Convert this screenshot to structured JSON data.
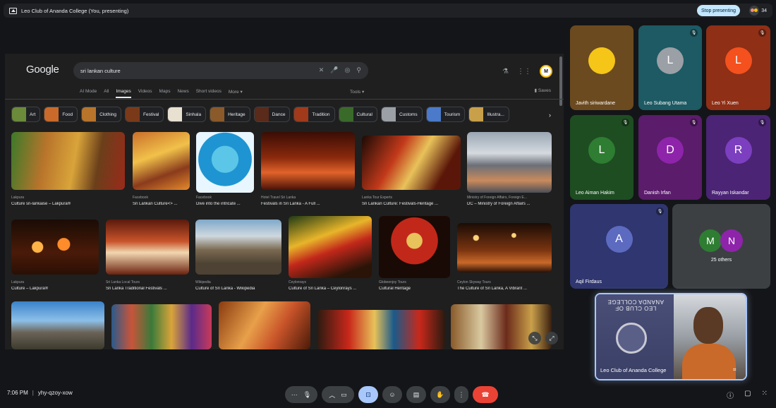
{
  "topbar": {
    "title": "Leo Club of Ananda College (You, presenting)",
    "stop_label": "Stop presenting",
    "participants_count": "34"
  },
  "google": {
    "logo": "Google",
    "query": "sri lankan culture",
    "tabs": [
      "AI Mode",
      "All",
      "Images",
      "Videos",
      "Maps",
      "News",
      "Short videos",
      "More ▾"
    ],
    "active_tab": "Images",
    "tools_label": "Tools ▾",
    "saves_label": "Saves",
    "avatar_letter": "M",
    "chips": [
      "Art",
      "Food",
      "Clothing",
      "Festival",
      "Sinhala",
      "Heritage",
      "Dance",
      "Tradition",
      "Cultural",
      "Customs",
      "Tourism",
      "Illustra..."
    ],
    "results_row1": [
      {
        "source": "Lakpura",
        "caption": "Culture sri-lankaise – Lakpura®"
      },
      {
        "source": "Facebook",
        "caption": "Sri Lankan Culture<> ..."
      },
      {
        "source": "Facebook",
        "caption": "Dive into the intricate ..."
      },
      {
        "source": "Hotel Travel Sri Lanka",
        "caption": "Festivals in Sri Lanka - A Full ..."
      },
      {
        "source": "Lanka Tour Experts",
        "caption": "Sri Lankan Culture: Festivals-Heritage ..."
      },
      {
        "source": "Ministry of Foreign Affairs, Foreign E...",
        "caption": "DC – Ministry of Foreign Affairs ..."
      }
    ],
    "results_row2": [
      {
        "source": "Lakpura",
        "caption": "Culture – Lakpura®"
      },
      {
        "source": "Sri Lanka Local Tours",
        "caption": "Sri Lanka Traditional Festivals ..."
      },
      {
        "source": "Wikipedia",
        "caption": "Culture of Sri Lanka - Wikipedia"
      },
      {
        "source": "Ceylonrays",
        "caption": "Culture of Sri Lanka – Ceylonrays ..."
      },
      {
        "source": "Globeenjoy Tours",
        "caption": "Cultural Heritage"
      },
      {
        "source": "Ceylon Skyway Tours",
        "caption": "The Culture of Sri Lanka, A Vibrant ..."
      }
    ]
  },
  "participants": [
    {
      "name": "Javith siriwardane",
      "initial": "",
      "bg": "#6b4a1f",
      "avatar_bg": "#f5c518",
      "muted": false
    },
    {
      "name": "Leo Subang Utama",
      "initial": "L",
      "bg": "#1d5a63",
      "avatar_bg": "#9aa0a6",
      "muted": true
    },
    {
      "name": "Leo Yi Xuen",
      "initial": "L",
      "bg": "#8e2f16",
      "avatar_bg": "#f4511e",
      "muted": true
    },
    {
      "name": "Leo Aiman Hakim",
      "initial": "L",
      "bg": "#1e4d22",
      "avatar_bg": "#2e7d32",
      "muted": true
    },
    {
      "name": "Danish Irfan",
      "initial": "D",
      "bg": "#5a1c6b",
      "avatar_bg": "#8e24aa",
      "muted": true
    },
    {
      "name": "Rayyan Iskandar",
      "initial": "R",
      "bg": "#4b2475",
      "avatar_bg": "#7b3fbf",
      "muted": true
    },
    {
      "name": "Aqil Firdaus",
      "initial": "A",
      "bg": "#2f3670",
      "avatar_bg": "#5c6bc0",
      "muted": true
    }
  ],
  "others": {
    "label": "25 others",
    "initials": [
      "M",
      "N"
    ]
  },
  "self": {
    "name": "Leo Club of Ananda College",
    "banner": "LEO CLUB OF ANANDA COLLEGE"
  },
  "bottom": {
    "time": "7:06 PM",
    "separator": "|",
    "meeting_code": "yhy-qzoy-xow"
  }
}
